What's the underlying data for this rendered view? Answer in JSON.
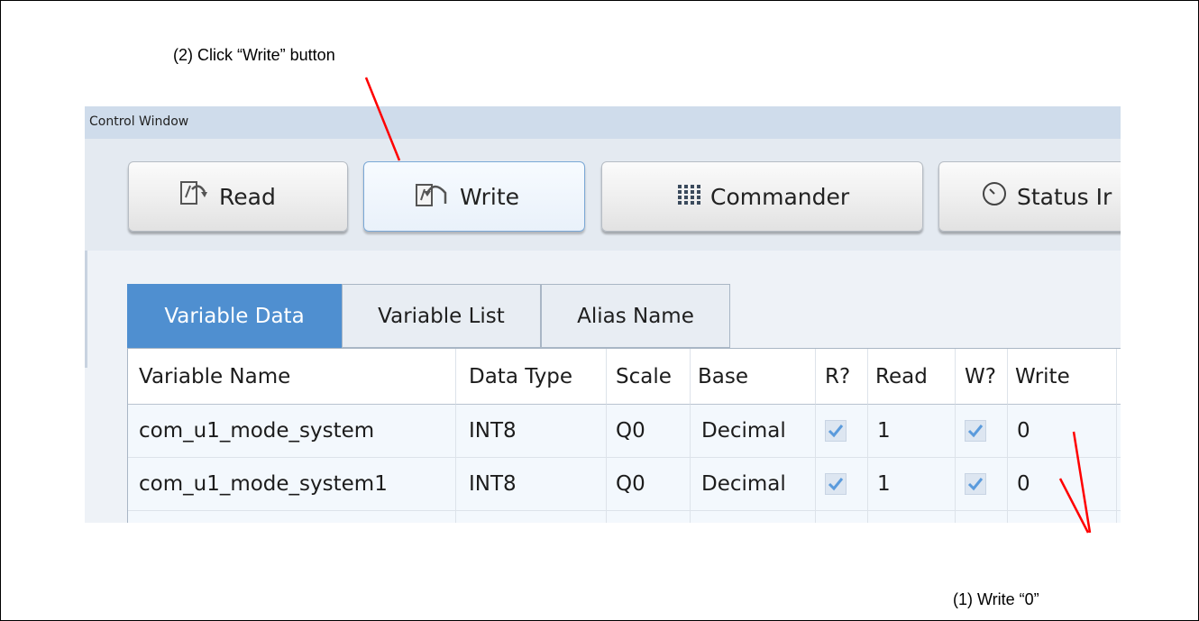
{
  "annotations": {
    "write_button_step": "(2) Click “Write” button",
    "write_zero_step": "(1) Write “0”"
  },
  "window": {
    "title": "Control Window"
  },
  "toolbar": {
    "read_label": "Read",
    "write_label": "Write",
    "commander_label": "Commander",
    "status_label": "Status Ir",
    "active": "Write"
  },
  "tabs": [
    {
      "label": "Variable Data",
      "selected": true
    },
    {
      "label": "Variable List",
      "selected": false
    },
    {
      "label": "Alias Name",
      "selected": false
    }
  ],
  "table": {
    "headers": [
      "Variable Name",
      "Data Type",
      "Scale",
      "Base",
      "R?",
      "Read",
      "W?",
      "Write"
    ],
    "rows": [
      {
        "name": "com_u1_mode_system",
        "type": "INT8",
        "scale": "Q0",
        "base": "Decimal",
        "r_checked": true,
        "read": "1",
        "w_checked": true,
        "write": "0"
      },
      {
        "name": "com_u1_mode_system1",
        "type": "INT8",
        "scale": "Q0",
        "base": "Decimal",
        "r_checked": true,
        "read": "1",
        "w_checked": true,
        "write": "0"
      }
    ]
  },
  "colors": {
    "annotation_line": "#ff0000",
    "tab_selected": "#4f8fd0",
    "checkmark": "#5b9bdc"
  },
  "icons": {
    "read": "read-icon",
    "write": "write-icon",
    "commander": "grid-icon",
    "status": "clock-icon",
    "check": "checkmark-icon"
  }
}
